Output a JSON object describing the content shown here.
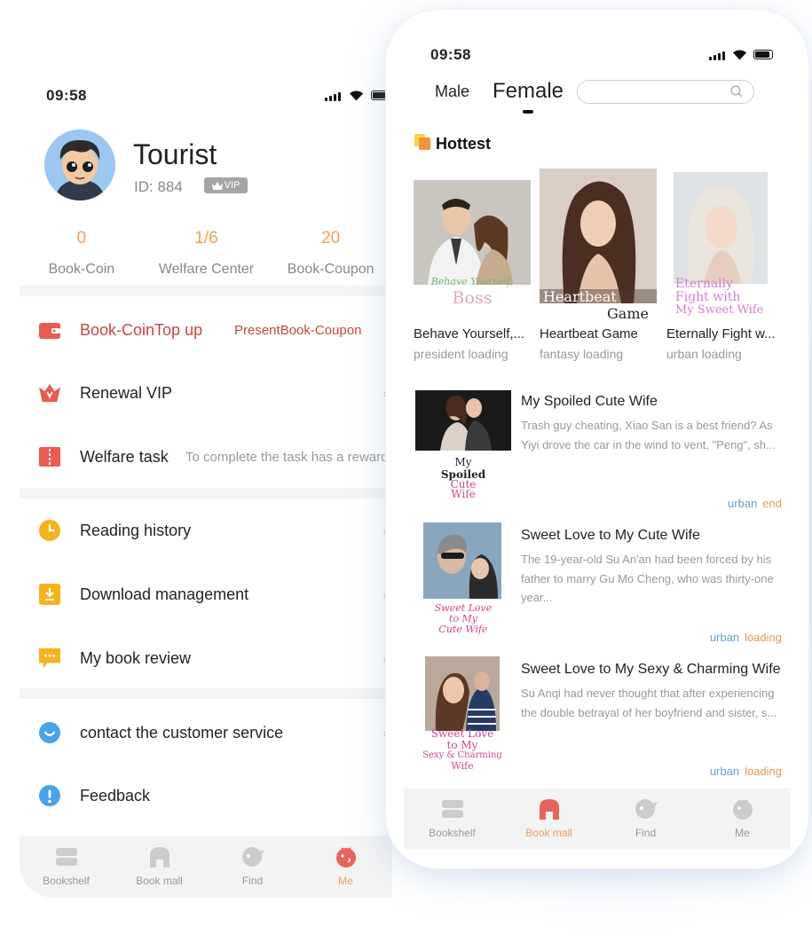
{
  "back_phone": {
    "status_time": "09:58",
    "user": {
      "name": "Tourist",
      "id_text": "ID:  884",
      "badge": "VIP"
    },
    "stats": [
      {
        "value": "0",
        "label": "Book-Coin"
      },
      {
        "value": "1/6",
        "label": "Welfare Center"
      },
      {
        "value": "20",
        "label": "Book-Coupon"
      }
    ],
    "menu": {
      "topup": {
        "label": "Book-CoinTop up",
        "extra": "PresentBook-Coupon"
      },
      "vip": {
        "label": "Renewal VIP"
      },
      "welfare": {
        "label": "Welfare task",
        "extra": "To complete the task has a reward"
      },
      "history": {
        "label": "Reading history"
      },
      "download": {
        "label": "Download management"
      },
      "review": {
        "label": "My book review"
      },
      "service": {
        "label": "contact the customer service"
      },
      "feedback": {
        "label": "Feedback"
      }
    },
    "tabs": [
      "Bookshelf",
      "Book mall",
      "Find",
      "Me"
    ],
    "active_tab": "Me"
  },
  "front_phone": {
    "status_time": "09:58",
    "gender_tabs": [
      "Male",
      "Female"
    ],
    "active_gender": "Female",
    "section_title": "Hottest",
    "hottest": [
      {
        "title": "Behave Yourself,...",
        "sub": "president loading",
        "cover_text_1": "Behave Yourself,",
        "cover_text_2": "Boss"
      },
      {
        "title": "Heartbeat Game",
        "sub": "fantasy loading",
        "cover_text_1": "Heartbeat",
        "cover_text_2": "Game"
      },
      {
        "title": "Eternally Fight w...",
        "sub": "urban loading",
        "cover_text_1": "Eternally",
        "cover_text_2": "Fight with",
        "cover_text_3": "My Sweet Wife"
      }
    ],
    "list": [
      {
        "title": "My Spoiled Cute Wife",
        "desc": "Trash guy cheating, Xiao San is a best friend? As Yiyi drove the car in the wind to vent, \"Peng\", sh...",
        "tag1": "urban",
        "tag2": "end",
        "cover_text_1": "My",
        "cover_text_2": "Spoiled",
        "cover_text_3": "Cute",
        "cover_text_4": "Wife"
      },
      {
        "title": "Sweet Love to My Cute Wife",
        "desc": "The 19-year-old Su An'an had been forced by his father to marry Gu Mo Cheng, who was thirty-one year...",
        "tag1": "urban",
        "tag2": "loading",
        "cover_text_1": "Sweet Love",
        "cover_text_2": "to My",
        "cover_text_3": "Cute Wife"
      },
      {
        "title": "Sweet Love to My Sexy & Charming Wife",
        "desc": "Su Anqi had never thought that after experiencing the double betrayal of her boyfriend and sister, s...",
        "tag1": "urban",
        "tag2": "loading",
        "cover_text_1": "Sweet Love",
        "cover_text_2": "to My",
        "cover_text_3": "Sexy & Charming",
        "cover_text_4": "Wife"
      }
    ],
    "tabs": [
      "Bookshelf",
      "Book mall",
      "Find",
      "Me"
    ],
    "active_tab": "Book mall"
  },
  "colors": {
    "accent_orange": "#e8a25a",
    "topup_red": "#c9463f",
    "tag_blue": "#6a9fce",
    "icon_red": "#ea5b52",
    "icon_yellow": "#f5b21c",
    "icon_blue": "#4aa3e8"
  },
  "icons": [
    "wallet-icon",
    "crown-icon",
    "ticket-icon",
    "clock-icon",
    "download-icon",
    "comment-icon",
    "chat-icon",
    "alert-icon",
    "search-icon",
    "fire-icon",
    "bookshelf-icon",
    "bookmall-icon",
    "find-icon",
    "me-icon"
  ]
}
